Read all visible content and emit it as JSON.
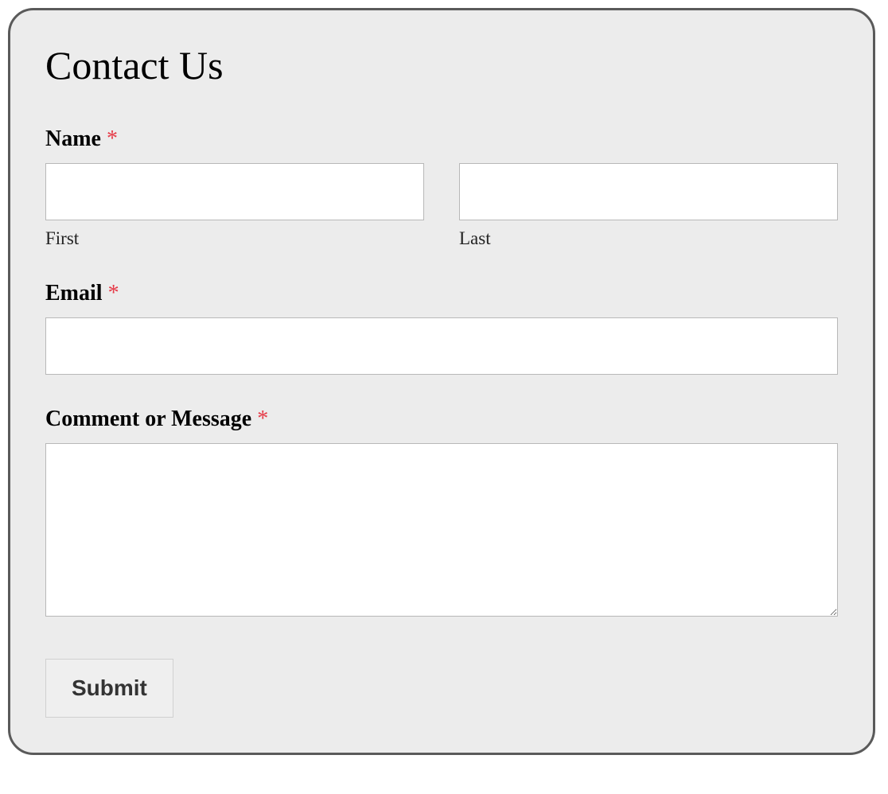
{
  "form": {
    "title": "Contact Us",
    "required_marker": "*",
    "fields": {
      "name": {
        "label": "Name",
        "first_sub": "First",
        "last_sub": "Last",
        "first_value": "",
        "last_value": ""
      },
      "email": {
        "label": "Email",
        "value": ""
      },
      "message": {
        "label": "Comment or Message",
        "value": ""
      }
    },
    "submit_label": "Submit"
  }
}
